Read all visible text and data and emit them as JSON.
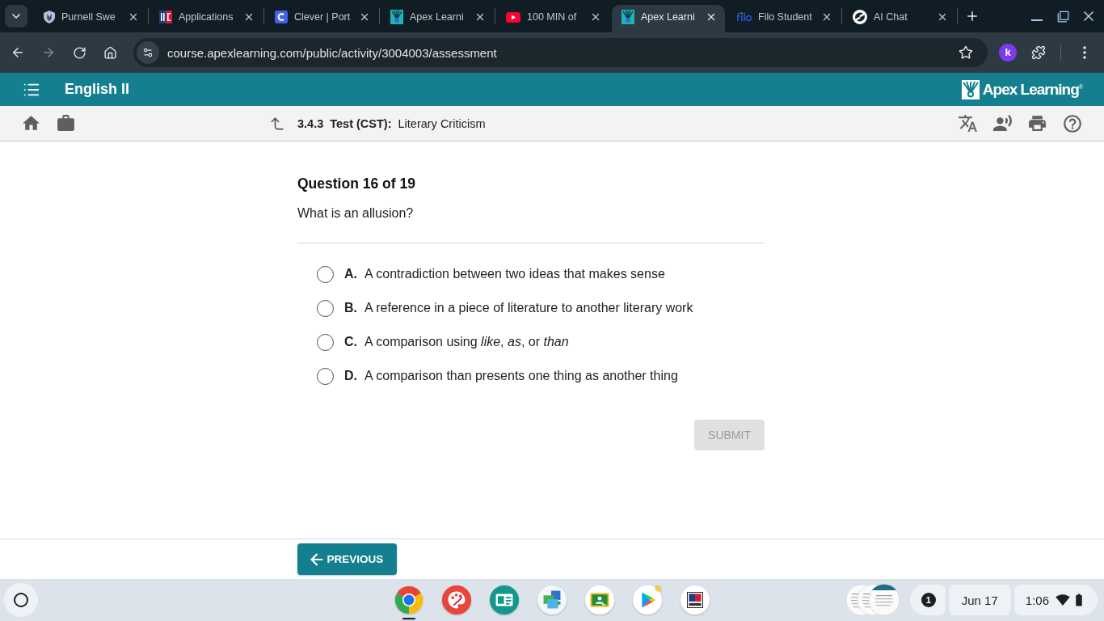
{
  "browser": {
    "tabs": [
      {
        "title": "Purnell Swe",
        "kind": "shield",
        "selected": false
      },
      {
        "title": "Applications",
        "kind": "split",
        "selected": false
      },
      {
        "title": "Clever | Port",
        "kind": "arc",
        "selected": false
      },
      {
        "title": "Apex Learni",
        "kind": "sunburst",
        "selected": false
      },
      {
        "title": "100 MIN of",
        "kind": "video",
        "selected": false
      },
      {
        "title": "Apex Learni",
        "kind": "sunburst",
        "selected": true
      },
      {
        "title": "Filo Student",
        "kind": "wordmark",
        "selected": false
      },
      {
        "title": "AI Chat",
        "kind": "swirl",
        "selected": false
      }
    ],
    "address": "course.apexlearning.com/public/activity/3004003/assessment",
    "extension": "k"
  },
  "header": {
    "course": "English II",
    "logo": "Apex Learning$^{®}$"
  },
  "toolbar": {
    "number": "3.4.3",
    "type": "Test (CST):",
    "title": "Literary Criticism"
  },
  "question": {
    "heading": "Question 16 of 19",
    "prompt": "What is an allusion?",
    "options": [
      {
        "letter": "A.",
        "text": "A contradiction between two ideas that makes sense",
        "selected": false
      },
      {
        "letter": "B.",
        "text": "A reference in a piece of literature to another literary work",
        "selected": false
      },
      {
        "letter": "C.",
        "text": "A comparison using *like*, *as*, or *than*",
        "selected": false
      },
      {
        "letter": "D.",
        "text": "A comparison than presents one thing as another thing",
        "selected": false
      }
    ],
    "submit": {
      "label": "SUBMIT",
      "disabled": true
    }
  },
  "footer": {
    "previous": "PREVIOUS"
  },
  "shelf": {
    "apps": [
      {
        "kind": "browser",
        "running": true
      },
      {
        "kind": "palette",
        "running": false
      },
      {
        "kind": "card",
        "running": false
      },
      {
        "kind": "windows",
        "running": false
      },
      {
        "kind": "board",
        "running": false
      },
      {
        "kind": "play",
        "running": false
      },
      {
        "kind": "test",
        "running": false
      }
    ],
    "notifications": "1",
    "date": "Jun 17",
    "time": "1:06"
  }
}
